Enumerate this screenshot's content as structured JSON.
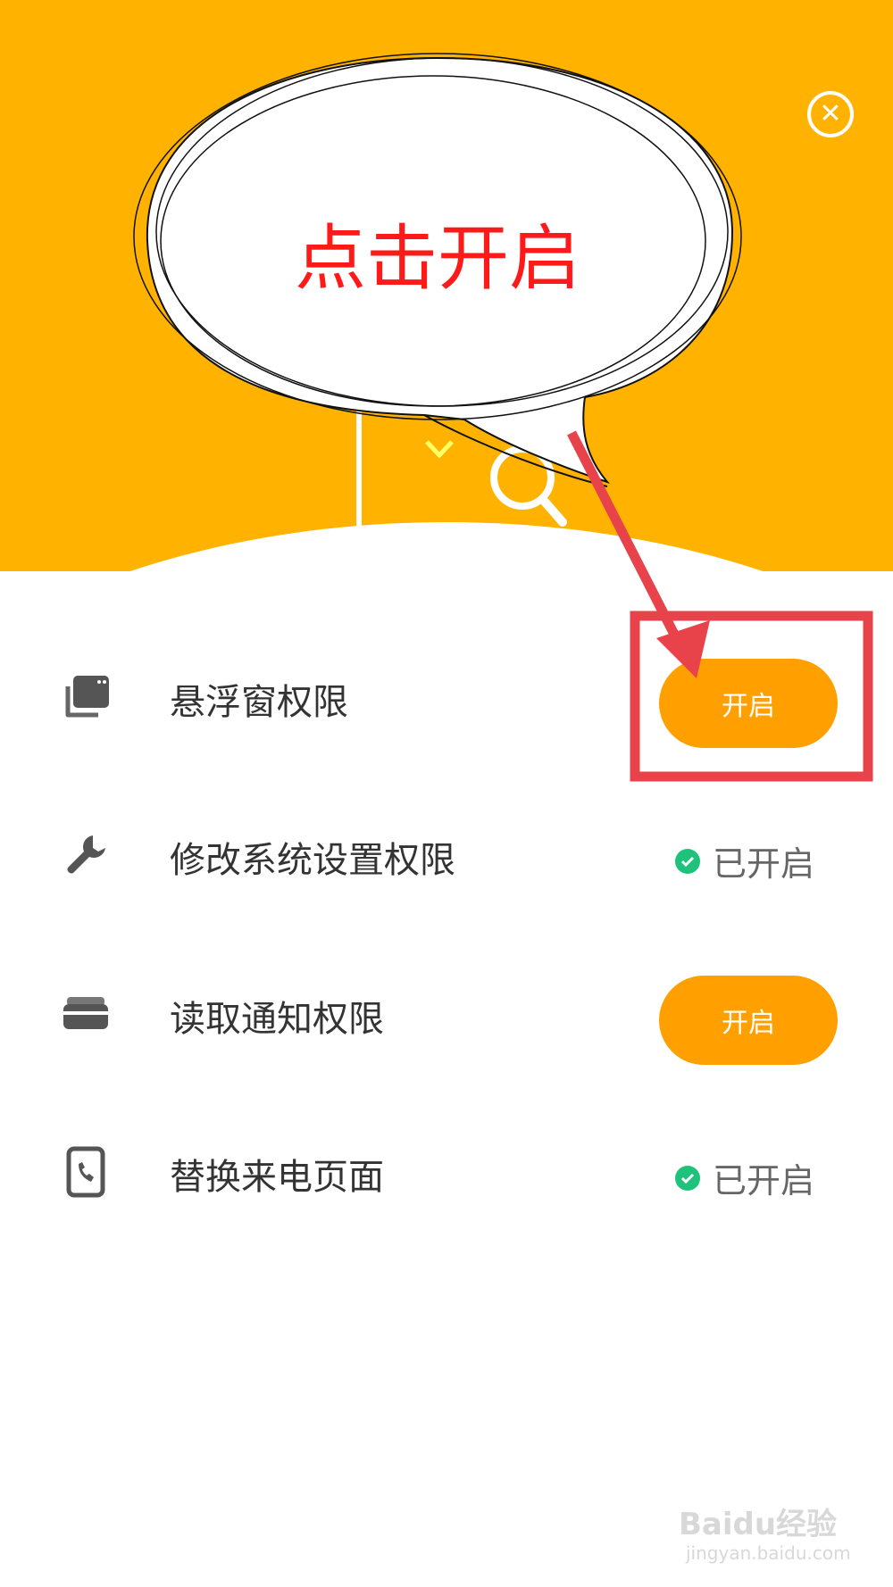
{
  "header": {
    "bg_color": "#FFB300",
    "close_icon": "close-icon"
  },
  "callout": {
    "text": "点击开启",
    "text_color": "#FF1A1A"
  },
  "permissions": [
    {
      "label": "悬浮窗权限",
      "icon": "floating-window-icon",
      "state": "button",
      "button_label": "开启"
    },
    {
      "label": "修改系统设置权限",
      "icon": "wrench-icon",
      "state": "enabled",
      "status_label": "已开启"
    },
    {
      "label": "读取通知权限",
      "icon": "notification-icon",
      "state": "button",
      "button_label": "开启"
    },
    {
      "label": "替换来电页面",
      "icon": "phone-icon",
      "state": "enabled",
      "status_label": "已开启"
    }
  ],
  "colors": {
    "button": "#FFA000",
    "enabled_check": "#1FC27A",
    "highlight_box": "#E8434B"
  },
  "watermark": {
    "main": "Baidu经验",
    "sub": "jingyan.baidu.com"
  }
}
